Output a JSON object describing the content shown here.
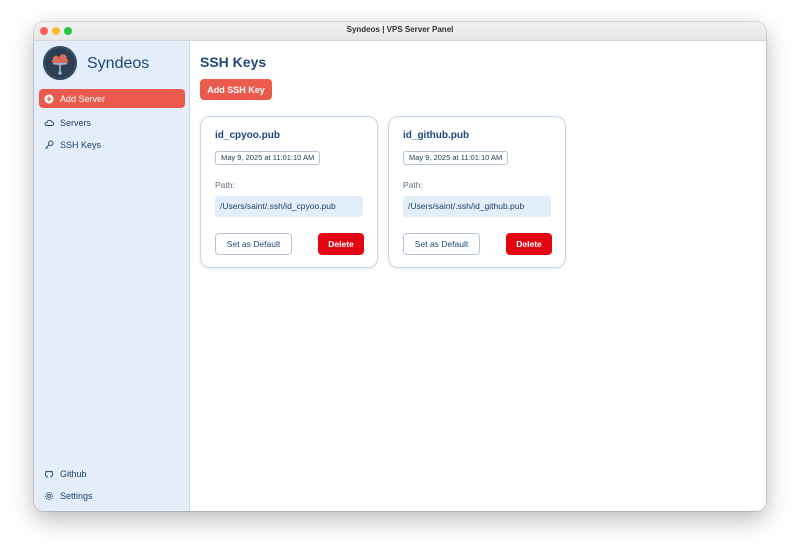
{
  "window": {
    "title": "Syndeos | VPS Server Panel"
  },
  "sidebar": {
    "brand": "Syndeos",
    "items": [
      {
        "label": "Add Server",
        "icon": "plus-circle-icon"
      },
      {
        "label": "Servers",
        "icon": "cloud-icon"
      },
      {
        "label": "SSH Keys",
        "icon": "key-icon"
      }
    ],
    "footer": [
      {
        "label": "Github",
        "icon": "github-icon"
      },
      {
        "label": "Settings",
        "icon": "gear-icon"
      }
    ]
  },
  "main": {
    "title": "SSH Keys",
    "add_button": "Add SSH Key",
    "cards": [
      {
        "name": "id_cpyoo.pub",
        "date": "May 9, 2025 at 11:01:10 AM",
        "path_label": "Path:",
        "path": "/Users/saint/.ssh/id_cpyoo.pub",
        "default_button": "Set as Default",
        "delete_button": "Delete"
      },
      {
        "name": "id_github.pub",
        "date": "May 9, 2025 at 11:01:10 AM",
        "path_label": "Path:",
        "path": "/Users/saint/.ssh/id_github.pub",
        "default_button": "Set as Default",
        "delete_button": "Delete"
      }
    ]
  },
  "colors": {
    "accent": "#eb5b4d",
    "danger": "#e30713",
    "sidebar_bg": "#e4eefa",
    "heading": "#1e4778"
  }
}
